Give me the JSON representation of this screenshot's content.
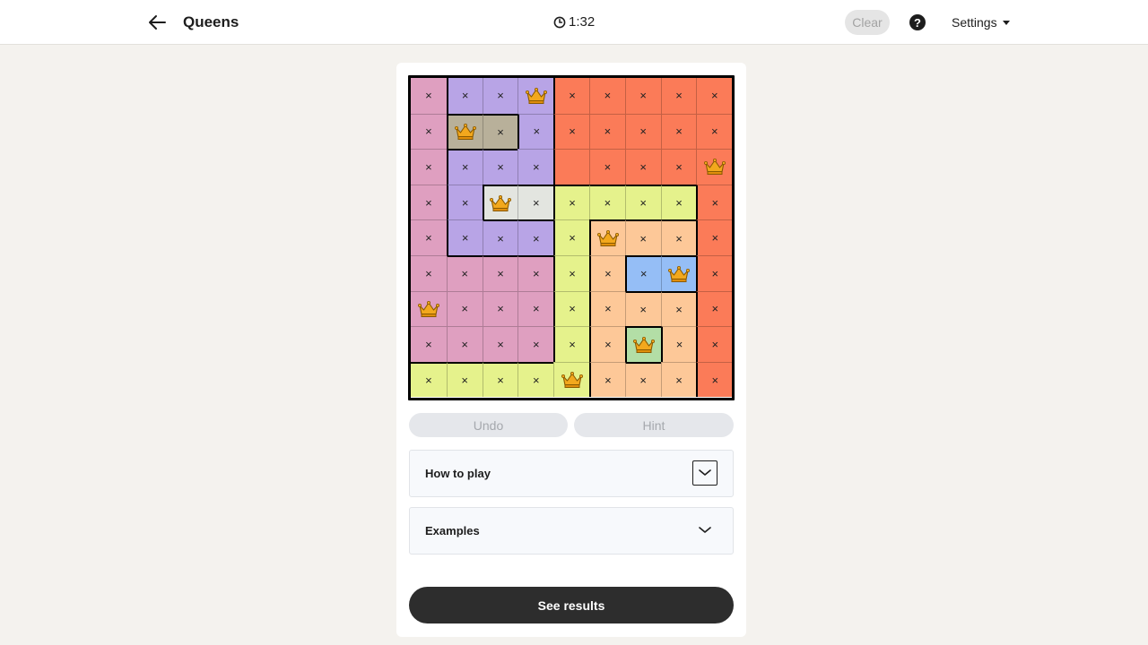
{
  "header": {
    "title": "Queens",
    "timer": "1:32",
    "clear_label": "Clear",
    "help_label": "?",
    "settings_label": "Settings"
  },
  "board": {
    "size": 9,
    "region_colors": {
      "P": "#df9fc0",
      "L": "#b8a4e6",
      "G": "#b8b09a",
      "O": "#fb7b58",
      "W": "#e3e5e0",
      "Y": "#e5f28c",
      "T": "#fdc898",
      "B": "#95bef6",
      "E": "#b3dea6"
    },
    "regions": [
      "PLLLOOOOO",
      "PGGLOOOOO",
      "PLLLOOOOO",
      "PLWWYYYYO",
      "PLLLYTTTO",
      "PPPPYTBBO",
      "PPPPYTTTO",
      "PPPPYTETO",
      "YYYYYTTTO"
    ],
    "marks": [
      "xxxQxxxxx",
      "xQxxxxxxx",
      "xxxx.xxxQ",
      "xxQxxxxxx",
      "xxxxxQxxx",
      "xxxxxxxQx",
      "Qxxxxxxxx",
      "xxxxxxQxx",
      "xxxxQxxxx"
    ],
    "mark_symbol": "×"
  },
  "controls": {
    "undo_label": "Undo",
    "hint_label": "Hint"
  },
  "accordions": [
    {
      "label": "How to play"
    },
    {
      "label": "Examples"
    }
  ],
  "results_label": "See results"
}
